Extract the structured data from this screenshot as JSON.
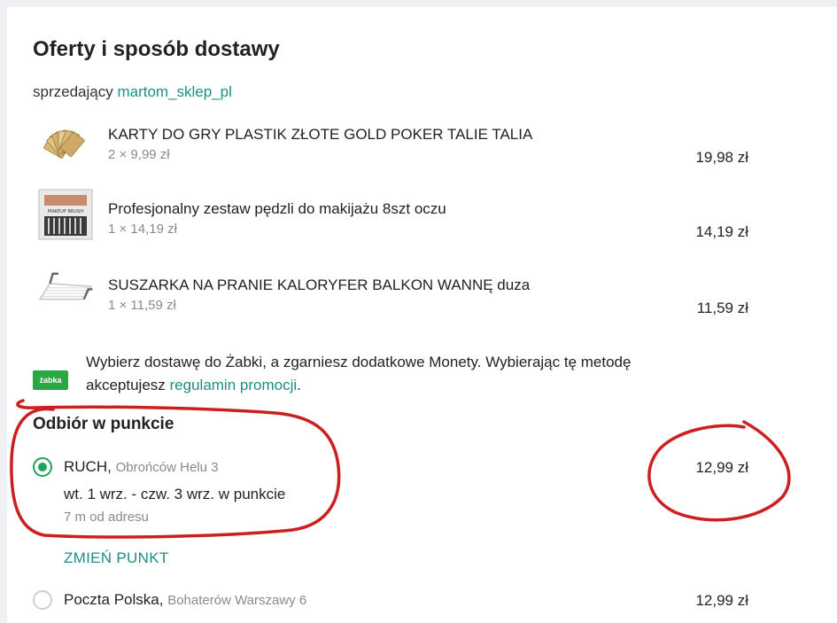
{
  "header": {
    "title": "Oferty i sposób dostawy",
    "seller_prefix": "sprzedający",
    "seller_name": "martom_sklep_pl"
  },
  "items": [
    {
      "name": "KARTY DO GRY PLASTIK ZŁOTE GOLD POKER TALIE TALIA",
      "qty": "2 × 9,99 zł",
      "price": "19,98 zł",
      "icon": "playing-cards-thumbnail"
    },
    {
      "name": "Profesjonalny zestaw pędzli do makijażu 8szt oczu",
      "qty": "1 × 14,19 zł",
      "price": "14,19 zł",
      "icon": "makeup-brushes-thumbnail"
    },
    {
      "name": "SUSZARKA NA PRANIE KALORYFER BALKON WANNĘ duza",
      "qty": "1 × 11,59 zł",
      "price": "11,59 zł",
      "icon": "drying-rack-thumbnail"
    }
  ],
  "promo": {
    "logo_text": "żabka",
    "text": "Wybierz dostawę do Żabki, a zgarniesz dodatkowe Monety. Wybierając tę metodę akceptujesz",
    "link_text": "regulamin promocji",
    "suffix": "."
  },
  "delivery": {
    "section_title": "Odbiór w punkcie",
    "options": [
      {
        "name": "RUCH,",
        "address": "Obrońców Helu 3",
        "time": "wt. 1 wrz. - czw. 3 wrz. w punkcie",
        "distance": "7 m od adresu",
        "price": "12,99 zł",
        "selected": true
      },
      {
        "name": "Poczta Polska,",
        "address": "Bohaterów Warszawy 6",
        "price": "12,99 zł",
        "selected": false
      }
    ],
    "change_label": "ZMIEŃ PUNKT"
  },
  "colors": {
    "accent_link": "#1a8f83",
    "radio_selected": "#1fa35a",
    "annotation": "#cc1f1f",
    "zabka_green": "#29a745"
  }
}
